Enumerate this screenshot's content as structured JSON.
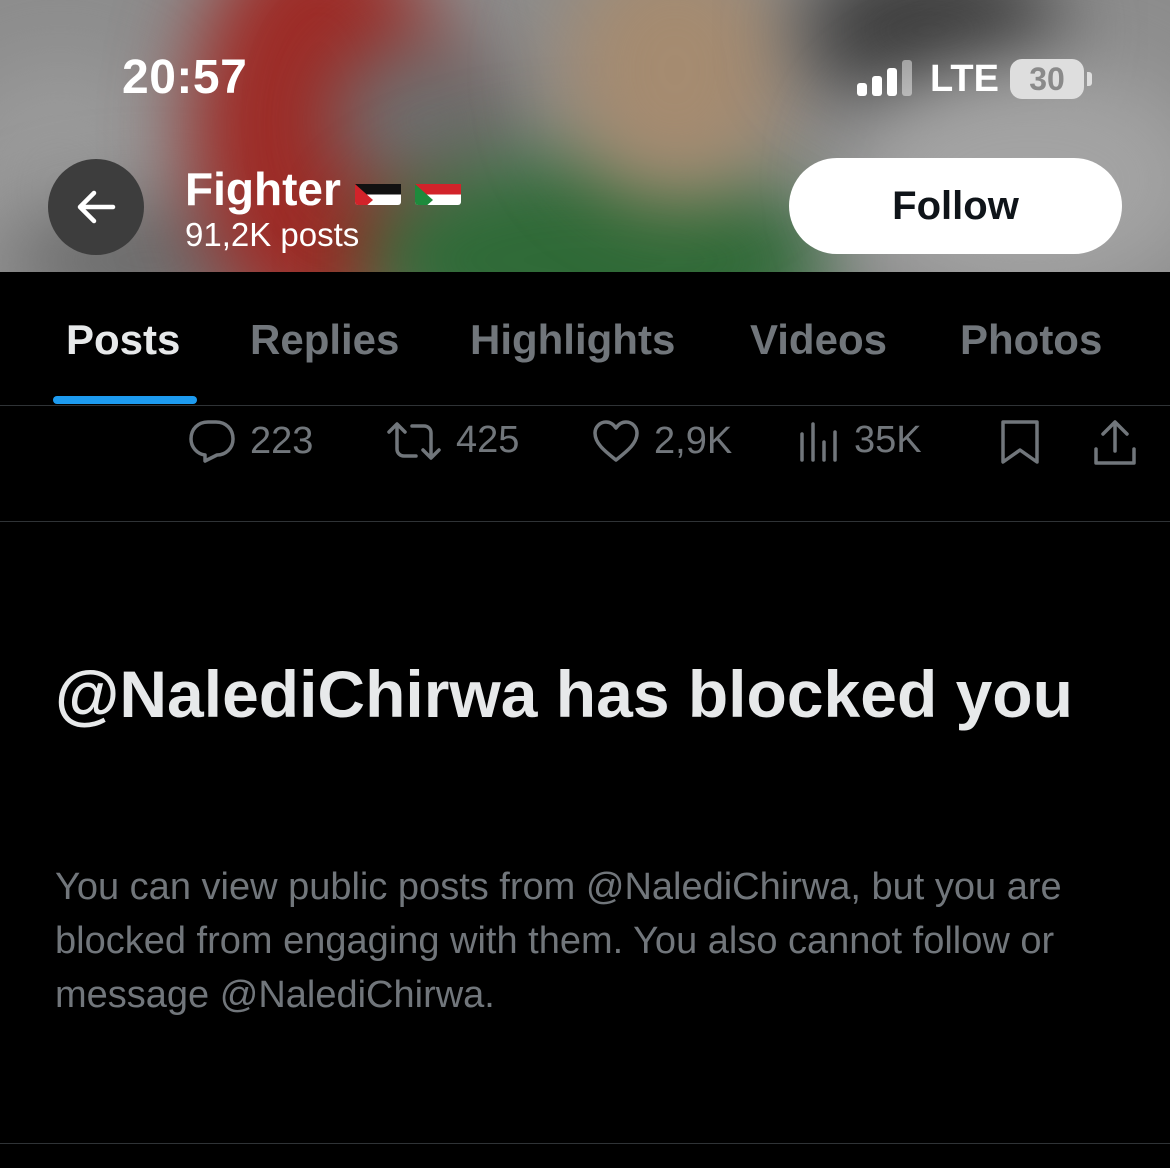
{
  "status_bar": {
    "time": "20:57",
    "network": "LTE",
    "battery": "30"
  },
  "header": {
    "profile_name": "Fighter",
    "flags": [
      "palestine-flag",
      "sudan-flag"
    ],
    "post_count": "91,2K posts",
    "follow_label": "Follow"
  },
  "tabs": [
    {
      "label": "Posts",
      "active": true
    },
    {
      "label": "Replies",
      "active": false
    },
    {
      "label": "Highlights",
      "active": false
    },
    {
      "label": "Videos",
      "active": false
    },
    {
      "label": "Photos",
      "active": false
    }
  ],
  "post_actions": {
    "replies": "223",
    "reposts": "425",
    "likes": "2,9K",
    "views": "35K"
  },
  "blocked": {
    "title": "@NalediChirwa has blocked you",
    "description": "You can view public posts from @NalediChirwa, but you are blocked from engaging with them. You also cannot follow or message @NalediChirwa."
  },
  "colors": {
    "accent": "#1d9bf0",
    "muted_text": "#71767b",
    "primary_text": "#e7e9ea",
    "background": "#000000"
  }
}
